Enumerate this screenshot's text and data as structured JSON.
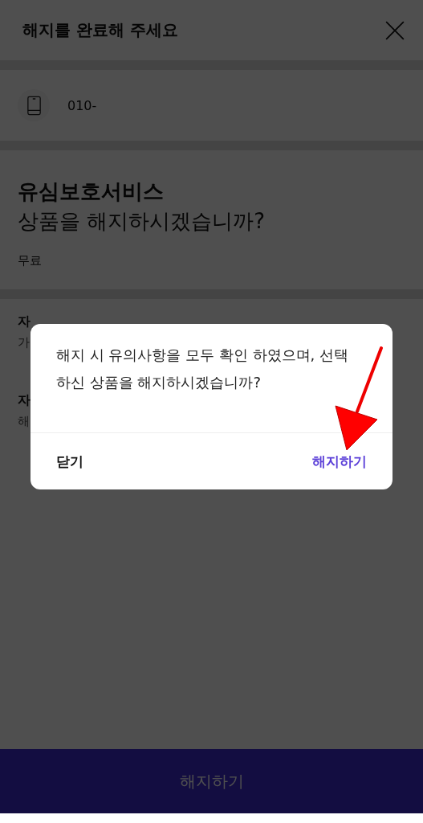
{
  "header": {
    "title": "해지를 완료해 주세요"
  },
  "line": {
    "number": "010-"
  },
  "product": {
    "name": "유심보호서비스",
    "question": "상품을 해지하시겠습니까?",
    "price": "무료"
  },
  "notices": [
    {
      "title": "자",
      "text": "가"
    },
    {
      "title": "자",
      "text": "해"
    }
  ],
  "dialog": {
    "message": "해지 시 유의사항을 모두 확인 하였으며, 선택하신 상품을 해지하시겠습니까?",
    "buttons": [
      {
        "label": "닫기",
        "kind": "cancel"
      },
      {
        "label": "해지하기",
        "kind": "confirm"
      }
    ]
  },
  "bottom_button": {
    "label": "해지하기"
  }
}
